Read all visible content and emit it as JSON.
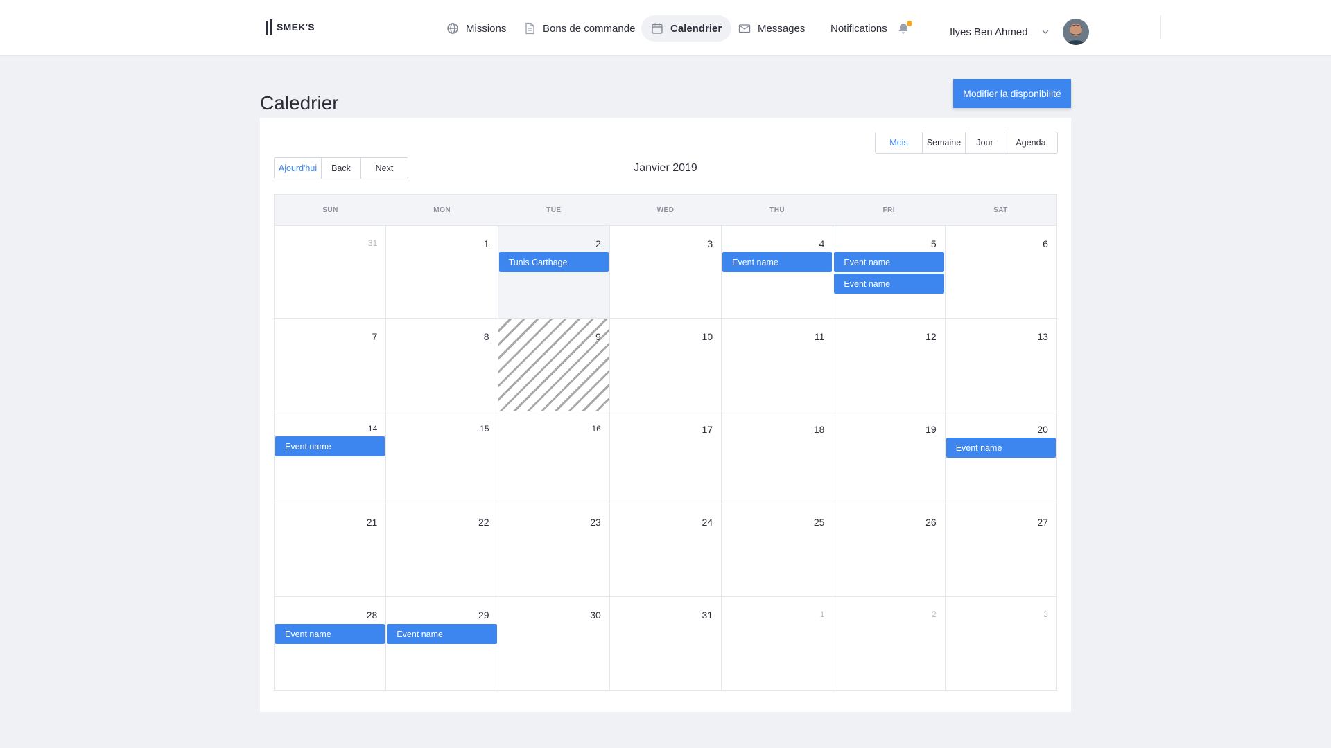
{
  "brand": {
    "name": "SMEK'S"
  },
  "nav": {
    "missions": "Missions",
    "bons": "Bons de commande",
    "calendrier": "Calendrier",
    "messages": "Messages",
    "notifications": "Notifications"
  },
  "user": {
    "name": "Ilyes Ben Ahmed"
  },
  "page": {
    "title": "Caledrier",
    "action_button": "Modifier la disponibilité"
  },
  "calendar": {
    "month_label": "Janvier 2019",
    "toolbar": {
      "today": "Ajourd'hui",
      "back": "Back",
      "next": "Next"
    },
    "views": {
      "month": "Mois",
      "week": "Semaine",
      "day": "Jour",
      "agenda": "Agenda"
    },
    "weekdays": [
      "SUN",
      "MON",
      "TUE",
      "WED",
      "THU",
      "FRI",
      "SAT"
    ],
    "days": {
      "w1": [
        "31",
        "1",
        "2",
        "3",
        "4",
        "5",
        "6"
      ],
      "w2": [
        "7",
        "8",
        "9",
        "10",
        "11",
        "12",
        "13"
      ],
      "w3": [
        "14",
        "15",
        "16",
        "17",
        "18",
        "19",
        "20"
      ],
      "w4": [
        "21",
        "22",
        "23",
        "24",
        "25",
        "26",
        "27"
      ],
      "w5": [
        "28",
        "29",
        "30",
        "31",
        "1",
        "2",
        "3"
      ]
    },
    "events": {
      "jan2": "Tunis Carthage",
      "jan4": "Event name",
      "jan5a": "Event name",
      "jan5b": "Event name",
      "jan14": "Event name",
      "jan20": "Event name",
      "jan28": "Event name",
      "jan29": "Event name"
    }
  },
  "colors": {
    "accent": "#3d86f0",
    "notification_dot": "#f5a623",
    "background": "#eff1f5"
  }
}
